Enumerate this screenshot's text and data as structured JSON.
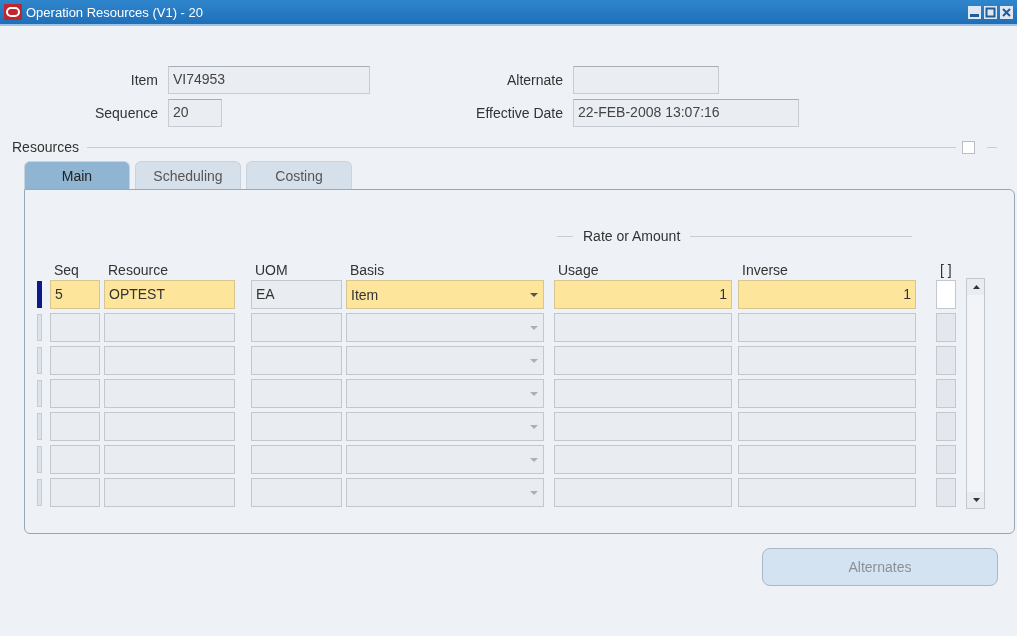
{
  "window": {
    "title": "Operation Resources (V1) - 20"
  },
  "header": {
    "item": {
      "label": "Item",
      "value": "VI74953"
    },
    "alternate": {
      "label": "Alternate"
    },
    "sequence": {
      "label": "Sequence",
      "value": "20"
    },
    "effective_date": {
      "label": "Effective Date",
      "value": "22-FEB-2008 13:07:16"
    }
  },
  "section": {
    "title": "Resources",
    "checked": false
  },
  "tabs": [
    {
      "label": "Main",
      "selected": true
    },
    {
      "label": "Scheduling",
      "selected": false
    },
    {
      "label": "Costing",
      "selected": false
    }
  ],
  "table": {
    "group_label": "Rate or Amount",
    "columns": [
      "Seq",
      "Resource",
      "UOM",
      "Basis",
      "Usage",
      "Inverse",
      "[ ]"
    ],
    "rows": [
      {
        "current": true,
        "checked": false,
        "seq": "5",
        "resource": "OPTEST",
        "uom": "EA",
        "basis": "Item",
        "usage": "1",
        "inverse": "1"
      },
      {
        "current": false,
        "checked": false
      },
      {
        "current": false,
        "checked": false
      },
      {
        "current": false,
        "checked": false
      },
      {
        "current": false,
        "checked": false
      },
      {
        "current": false,
        "checked": false
      },
      {
        "current": false,
        "checked": false
      }
    ]
  },
  "buttons": [
    {
      "label": "Alternates",
      "disabled": true
    }
  ]
}
